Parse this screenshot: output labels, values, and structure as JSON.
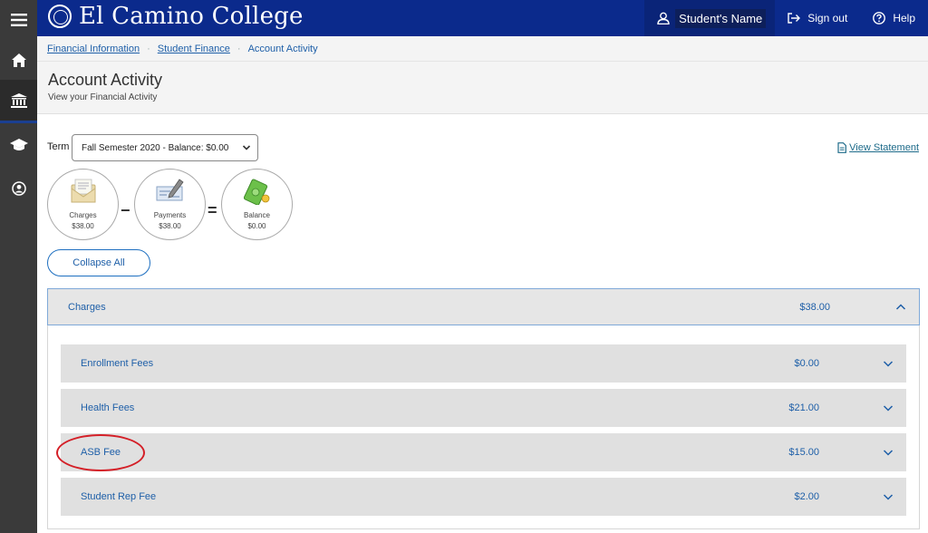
{
  "header": {
    "logo_text": "El Camino College",
    "user_name": "Student's Name",
    "sign_out": "Sign out",
    "help": "Help",
    "brand_color": "#0b2a8c"
  },
  "breadcrumb": {
    "items": [
      "Financial Information",
      "Student Finance"
    ],
    "current": "Account Activity"
  },
  "page": {
    "title": "Account Activity",
    "subtitle": "View your Financial Activity"
  },
  "term": {
    "label": "Term",
    "selected": "Fall Semester 2020 - Balance: $0.00"
  },
  "view_statement": "View Statement",
  "summary": {
    "charges_label": "Charges",
    "charges_amount": "$38.00",
    "payments_label": "Payments",
    "payments_amount": "$38.00",
    "balance_label": "Balance",
    "balance_amount": "$0.00",
    "minus": "−",
    "equals": "="
  },
  "collapse_all": "Collapse All",
  "charges": {
    "label": "Charges",
    "amount": "$38.00",
    "items": [
      {
        "label": "Enrollment Fees",
        "amount": "$0.00"
      },
      {
        "label": "Health Fees",
        "amount": "$21.00"
      },
      {
        "label": "ASB Fee",
        "amount": "$15.00"
      },
      {
        "label": "Student Rep Fee",
        "amount": "$2.00"
      }
    ]
  },
  "icons": [
    "menu-icon",
    "home-icon",
    "bank-icon",
    "graduation-cap-icon",
    "user-circle-icon",
    "user-icon",
    "sign-out-icon",
    "help-icon",
    "document-icon",
    "chevron-down-icon",
    "chevron-up-icon"
  ],
  "annotation_color": "#d41f27"
}
